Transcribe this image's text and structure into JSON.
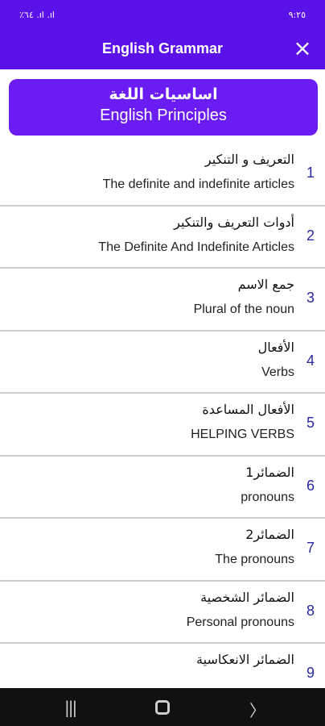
{
  "statusbar": {
    "left": "٪٦٤ .ıl .ıl",
    "right": "٩:٢٥"
  },
  "appbar": {
    "title": "English Grammar",
    "close_icon": "×"
  },
  "banner": {
    "arabic": "اساسيات اللغة",
    "english": "English Principles"
  },
  "items": [
    {
      "num": "1",
      "ar": "التعريف و التنكير",
      "en": "The definite and indefinite articles"
    },
    {
      "num": "2",
      "ar": "أدوات التعريف والتنكير",
      "en": "The Definite And Indefinite Articles"
    },
    {
      "num": "3",
      "ar": "جمع الاسم",
      "en": "Plural of the noun"
    },
    {
      "num": "4",
      "ar": "الأفعال",
      "en": "Verbs"
    },
    {
      "num": "5",
      "ar": "الأفعال المساعدة",
      "en": "HELPING VERBS"
    },
    {
      "num": "6",
      "ar": "الضمائر1",
      "en": "pronouns"
    },
    {
      "num": "7",
      "ar": "الضمائر2",
      "en": "The pronouns"
    },
    {
      "num": "8",
      "ar": "الضمائر الشخصية",
      "en": "Personal pronouns"
    },
    {
      "num": "9",
      "ar": "الضمائر الانعكاسية",
      "en": ""
    }
  ],
  "navbar": {
    "recent": "|||",
    "back": "〉"
  },
  "colors": {
    "primary": "#5a12e8",
    "banner": "#6a1cf2",
    "number": "#2a2aa0"
  }
}
